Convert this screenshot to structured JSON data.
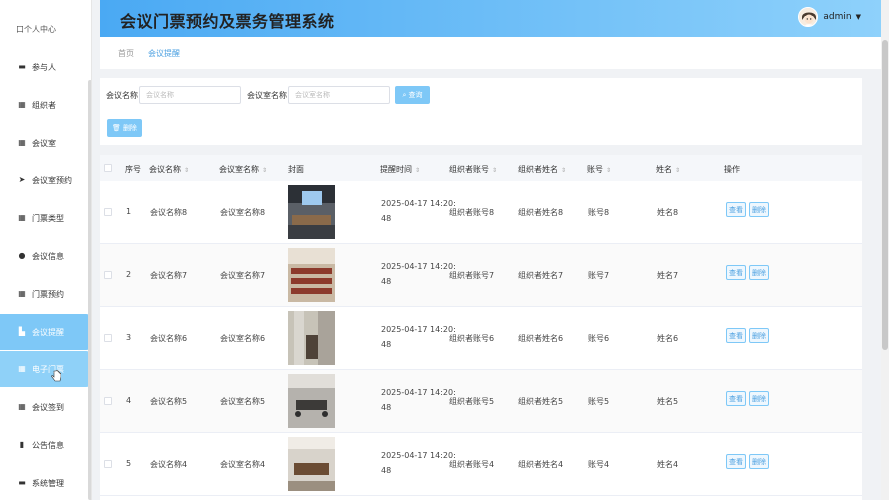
{
  "app": {
    "title": "会议门票预约及票务管理系统",
    "user": "admin"
  },
  "sidebar": {
    "cut_label": "口个人中心",
    "items": [
      {
        "label": "参与人",
        "icon": "id-card-icon"
      },
      {
        "label": "组织者",
        "icon": "grid-icon"
      },
      {
        "label": "会议室",
        "icon": "grid-icon"
      },
      {
        "label": "会议室预约",
        "icon": "send-icon"
      },
      {
        "label": "门票类型",
        "icon": "grid-icon"
      },
      {
        "label": "会议信息",
        "icon": "location-icon"
      },
      {
        "label": "门票预约",
        "icon": "grid-icon"
      },
      {
        "label": "会议提醒",
        "icon": "chart-icon"
      },
      {
        "label": "电子门票",
        "icon": "grid-icon"
      },
      {
        "label": "会议签到",
        "icon": "grid-icon"
      },
      {
        "label": "公告信息",
        "icon": "bar-chart-icon"
      },
      {
        "label": "系统管理",
        "icon": "id-card-icon"
      }
    ]
  },
  "breadcrumb": {
    "home": "首页",
    "current": "会议提醒"
  },
  "search": {
    "label1": "会议名称",
    "placeholder1": "会议名称",
    "label2": "会议室名称",
    "placeholder2": "会议室名称",
    "search_label": "查询",
    "delete_label": "删除"
  },
  "table": {
    "headers": [
      "序号",
      "会议名称",
      "会议室名称",
      "封面",
      "提醒时间",
      "组织者账号",
      "组织者姓名",
      "账号",
      "姓名",
      "操作"
    ],
    "rows": [
      {
        "index": "1",
        "meeting": "会议名称8",
        "room": "会议室名称8",
        "time1": "2025-04-17 14:20:",
        "time2": "48",
        "org_acc": "组织者账号8",
        "org_name": "组织者姓名8",
        "acc": "账号8",
        "name": "姓名8"
      },
      {
        "index": "2",
        "meeting": "会议名称7",
        "room": "会议室名称7",
        "time1": "2025-04-17 14:20:",
        "time2": "48",
        "org_acc": "组织者账号7",
        "org_name": "组织者姓名7",
        "acc": "账号7",
        "name": "姓名7"
      },
      {
        "index": "3",
        "meeting": "会议名称6",
        "room": "会议室名称6",
        "time1": "2025-04-17 14:20:",
        "time2": "48",
        "org_acc": "组织者账号6",
        "org_name": "组织者姓名6",
        "acc": "账号6",
        "name": "姓名6"
      },
      {
        "index": "4",
        "meeting": "会议名称5",
        "room": "会议室名称5",
        "time1": "2025-04-17 14:20:",
        "time2": "48",
        "org_acc": "组织者账号5",
        "org_name": "组织者姓名5",
        "acc": "账号5",
        "name": "姓名5"
      },
      {
        "index": "5",
        "meeting": "会议名称4",
        "room": "会议室名称4",
        "time1": "2025-04-17 14:20:",
        "time2": "48",
        "org_acc": "组织者账号4",
        "org_name": "组织者姓名4",
        "acc": "账号4",
        "name": "姓名4"
      }
    ],
    "view_label": "查看",
    "delete_label": "删除"
  },
  "colors": {
    "accent": "#7ec8f7",
    "header_start": "#4aa9f3",
    "header_end": "#8ed1fb"
  }
}
